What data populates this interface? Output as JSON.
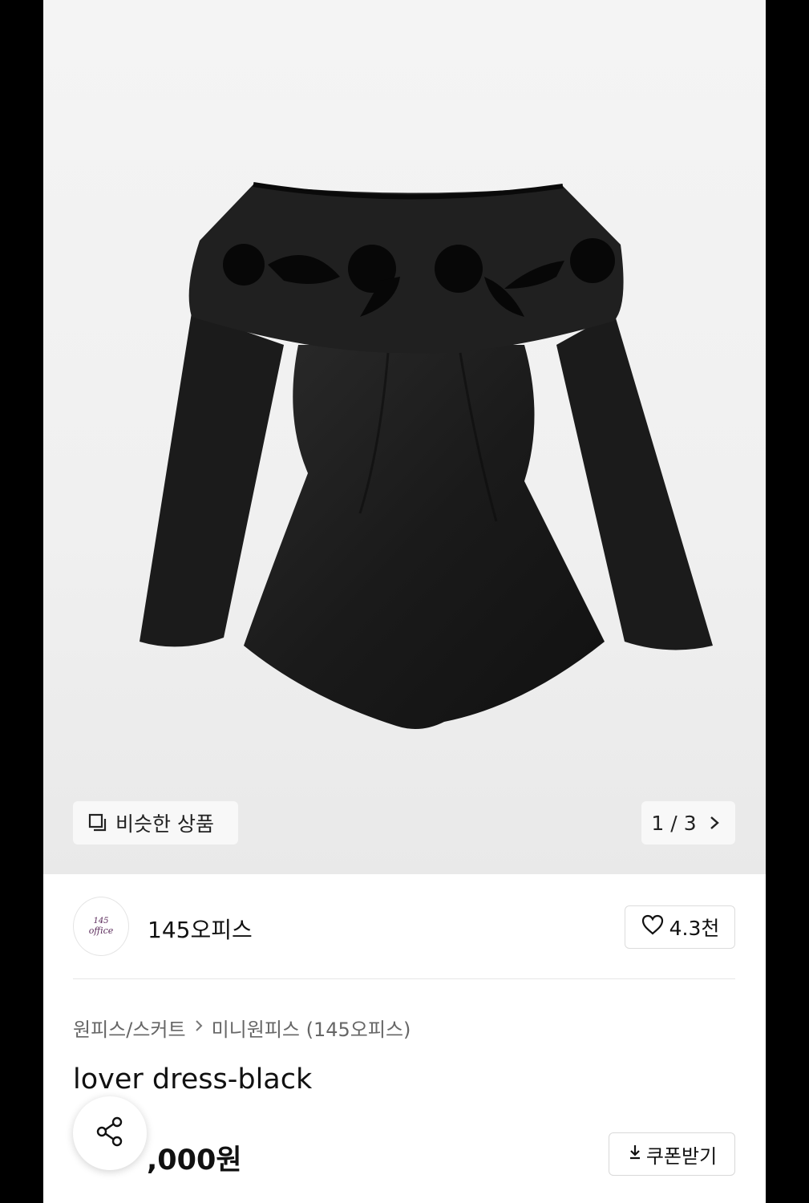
{
  "gallery": {
    "similar_label": "비슷한 상품",
    "current_page": "1",
    "separator": "/",
    "total_pages": "3"
  },
  "shop": {
    "logo_line1": "145",
    "logo_line2": "office",
    "name": "145오피스",
    "like_count": "4.3천"
  },
  "breadcrumb": {
    "category": "원피스/스커트",
    "subcategory": "미니원피스 (145오피스)"
  },
  "product": {
    "title": "lover dress-black",
    "price_visible": ",000원"
  },
  "actions": {
    "coupon_label": "쿠폰받기"
  },
  "icons": {
    "similar": "copy-squares-icon",
    "next": "chevron-right-icon",
    "like": "heart-outline-icon",
    "share": "share-icon",
    "download": "download-arrow-icon"
  }
}
